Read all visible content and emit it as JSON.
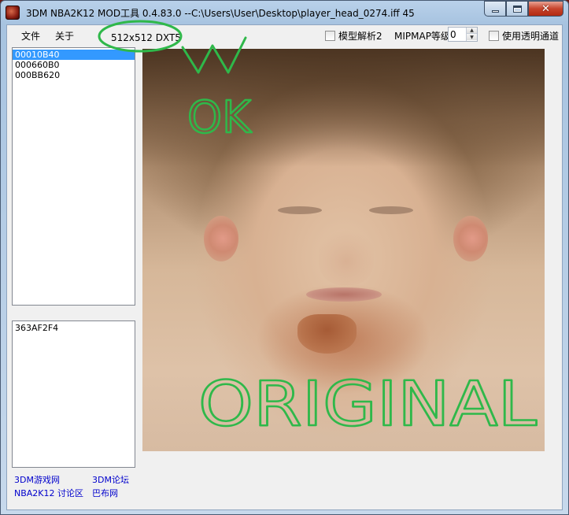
{
  "window": {
    "title": "3DM NBA2K12 MOD工具 0.4.83.0 --C:\\Users\\User\\Desktop\\player_head_0274.iff  45"
  },
  "menu": {
    "file": "文件",
    "about": "关于"
  },
  "texture_format": "512x512 DXT5",
  "options": {
    "model_parse_label": "模型解析2",
    "mipmap_label": "MIPMAP等级",
    "mipmap_value": "0",
    "transparency_label": "使用透明通道"
  },
  "top_list": {
    "items": [
      "00010B40",
      "000660B0",
      "000BB620"
    ],
    "selected_index": 0
  },
  "bottom_list": {
    "items": [
      "363AF2F4"
    ]
  },
  "links": {
    "site_3dm": "3DM游戏网",
    "forum_3dm": "3DM论坛",
    "nba2k12_area": "NBA2K12 讨论区",
    "babu": "巴布网"
  },
  "handwritten_annotations": {
    "top": "OK",
    "bottom": "ORIGINAL"
  },
  "colors": {
    "selection": "#3399ff",
    "link": "#0000cc",
    "annotation_ink": "#2fb84a"
  }
}
